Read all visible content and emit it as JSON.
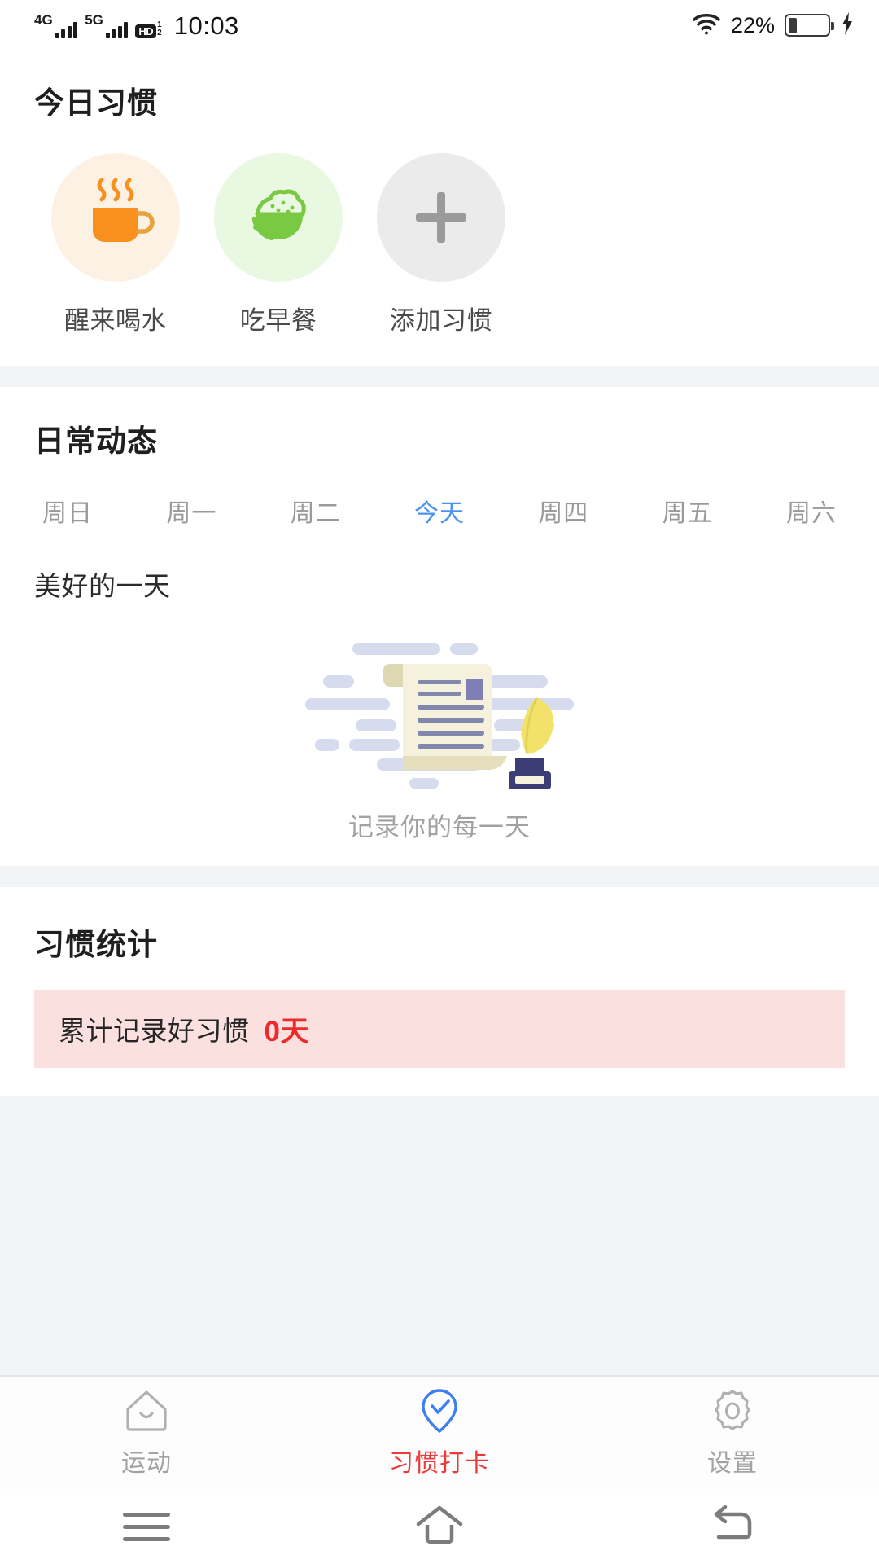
{
  "status_bar": {
    "network_1": "4G",
    "network_2": "5G",
    "hd_label": "HD",
    "hd_sup": "1",
    "hd_sub": "2",
    "time": "10:03",
    "battery_percent": "22%",
    "wifi_icon": "wifi-icon",
    "battery_icon": "battery-icon",
    "charging_icon": "charging-bolt-icon",
    "battery_level": 22
  },
  "today_habits": {
    "title": "今日习惯",
    "items": [
      {
        "label": "醒来喝水",
        "icon": "coffee-mug-icon",
        "circle_color": "#fdf1e4",
        "icon_color": "#f7901e"
      },
      {
        "label": "吃早餐",
        "icon": "rice-bowl-icon",
        "circle_color": "#e9f8e0",
        "icon_color": "#7ac943"
      },
      {
        "label": "添加习惯",
        "icon": "plus-icon",
        "circle_color": "#ebebeb",
        "icon_color": "#9b9b9b"
      }
    ]
  },
  "daily_feed": {
    "title": "日常动态",
    "weekdays": [
      {
        "label": "周日",
        "active": false
      },
      {
        "label": "周一",
        "active": false
      },
      {
        "label": "周二",
        "active": false
      },
      {
        "label": "今天",
        "active": true
      },
      {
        "label": "周四",
        "active": false
      },
      {
        "label": "周五",
        "active": false
      },
      {
        "label": "周六",
        "active": false
      }
    ],
    "active_color": "#4c93f0",
    "entry_title": "美好的一天",
    "empty_illustration": "scroll-quill-inkwell-illustration",
    "empty_text": "记录你的每一天"
  },
  "habit_stats": {
    "title": "习惯统计",
    "banner_label": "累计记录好习惯",
    "banner_value": "0天",
    "banner_bg": "#fbe0e0",
    "banner_value_color": "#ef2a2a"
  },
  "tabbar": {
    "items": [
      {
        "label": "运动",
        "icon": "home-house-icon",
        "active": false
      },
      {
        "label": "习惯打卡",
        "icon": "pin-check-icon",
        "active": true
      },
      {
        "label": "设置",
        "icon": "gear-icon",
        "active": false
      }
    ],
    "active_label_color": "#ec3a3a",
    "active_icon_color": "#3d7ef0"
  },
  "system_nav": {
    "recents": "menu-recents-icon",
    "home": "home-icon",
    "back": "back-icon"
  }
}
